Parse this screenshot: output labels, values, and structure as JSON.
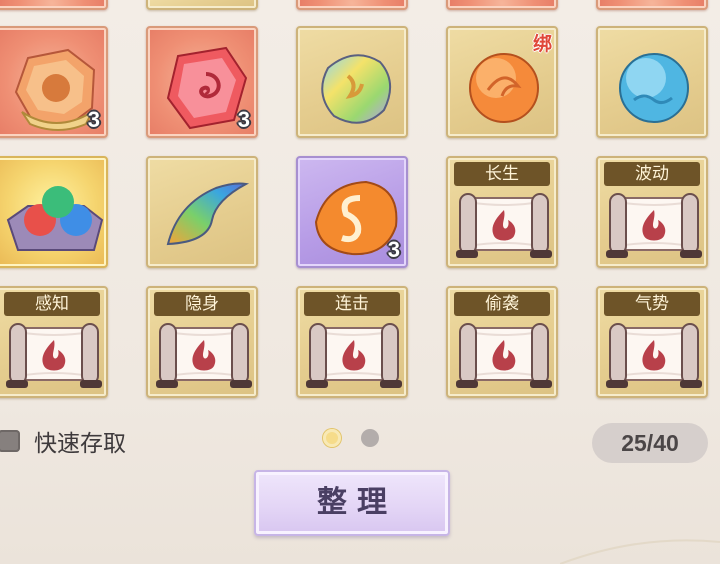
{
  "inventory": {
    "row1": [
      {
        "name": "red-crest-gem",
        "count": "3",
        "theme": "red"
      },
      {
        "name": "red-crystal-gem",
        "count": "3",
        "theme": "red"
      },
      {
        "name": "rainbow-stone",
        "count": "",
        "theme": "normal"
      },
      {
        "name": "orange-orb",
        "count": "",
        "theme": "normal",
        "bound": "绑"
      },
      {
        "name": "blue-orb",
        "count": "",
        "theme": "normal"
      }
    ],
    "row2": [
      {
        "name": "three-orb-tray",
        "theme": "gold"
      },
      {
        "name": "rainbow-shard",
        "theme": "normal"
      },
      {
        "name": "orange-pebble",
        "count": "3",
        "theme": "purple"
      },
      {
        "name": "skill-scroll",
        "title": "长生",
        "theme": "normal"
      },
      {
        "name": "skill-scroll",
        "title": "波动",
        "theme": "normal"
      }
    ],
    "row3": [
      {
        "name": "skill-scroll",
        "title": "感知"
      },
      {
        "name": "skill-scroll",
        "title": "隐身"
      },
      {
        "name": "skill-scroll",
        "title": "连击"
      },
      {
        "name": "skill-scroll",
        "title": "偷袭"
      },
      {
        "name": "skill-scroll",
        "title": "气势"
      }
    ]
  },
  "quick_access": {
    "label": "快速存取"
  },
  "pagination": {
    "current": 1,
    "total": 2
  },
  "capacity": {
    "text": "25/40"
  },
  "sort_button": {
    "label": "整理"
  },
  "colors": {
    "slot_border": "#cdb37a",
    "scroll_header": "#6e5428",
    "button_text": "#4a3f63"
  }
}
